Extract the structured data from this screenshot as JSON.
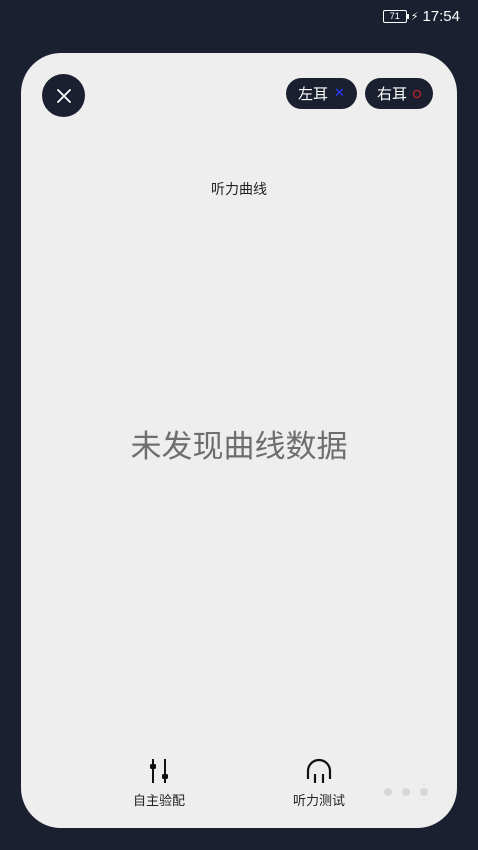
{
  "status": {
    "battery": "71",
    "time": "17:54"
  },
  "header": {
    "left_ear_label": "左耳",
    "right_ear_label": "右耳"
  },
  "chart": {
    "title": "听力曲线",
    "empty_message": "未发现曲线数据"
  },
  "bottom_nav": {
    "self_fit_label": "自主验配",
    "hearing_test_label": "听力测试"
  },
  "colors": {
    "background": "#1b2030",
    "card": "#eeeeee",
    "left_ear_marker": "#2d3cff",
    "right_ear_marker": "#e0202a"
  },
  "icons": {
    "close": "close-icon",
    "left_marker": "x-mark-icon",
    "right_marker": "circle-mark-icon",
    "self_fit": "sliders-icon",
    "hearing_test": "headphones-icon",
    "more": "more-dots-icon"
  }
}
